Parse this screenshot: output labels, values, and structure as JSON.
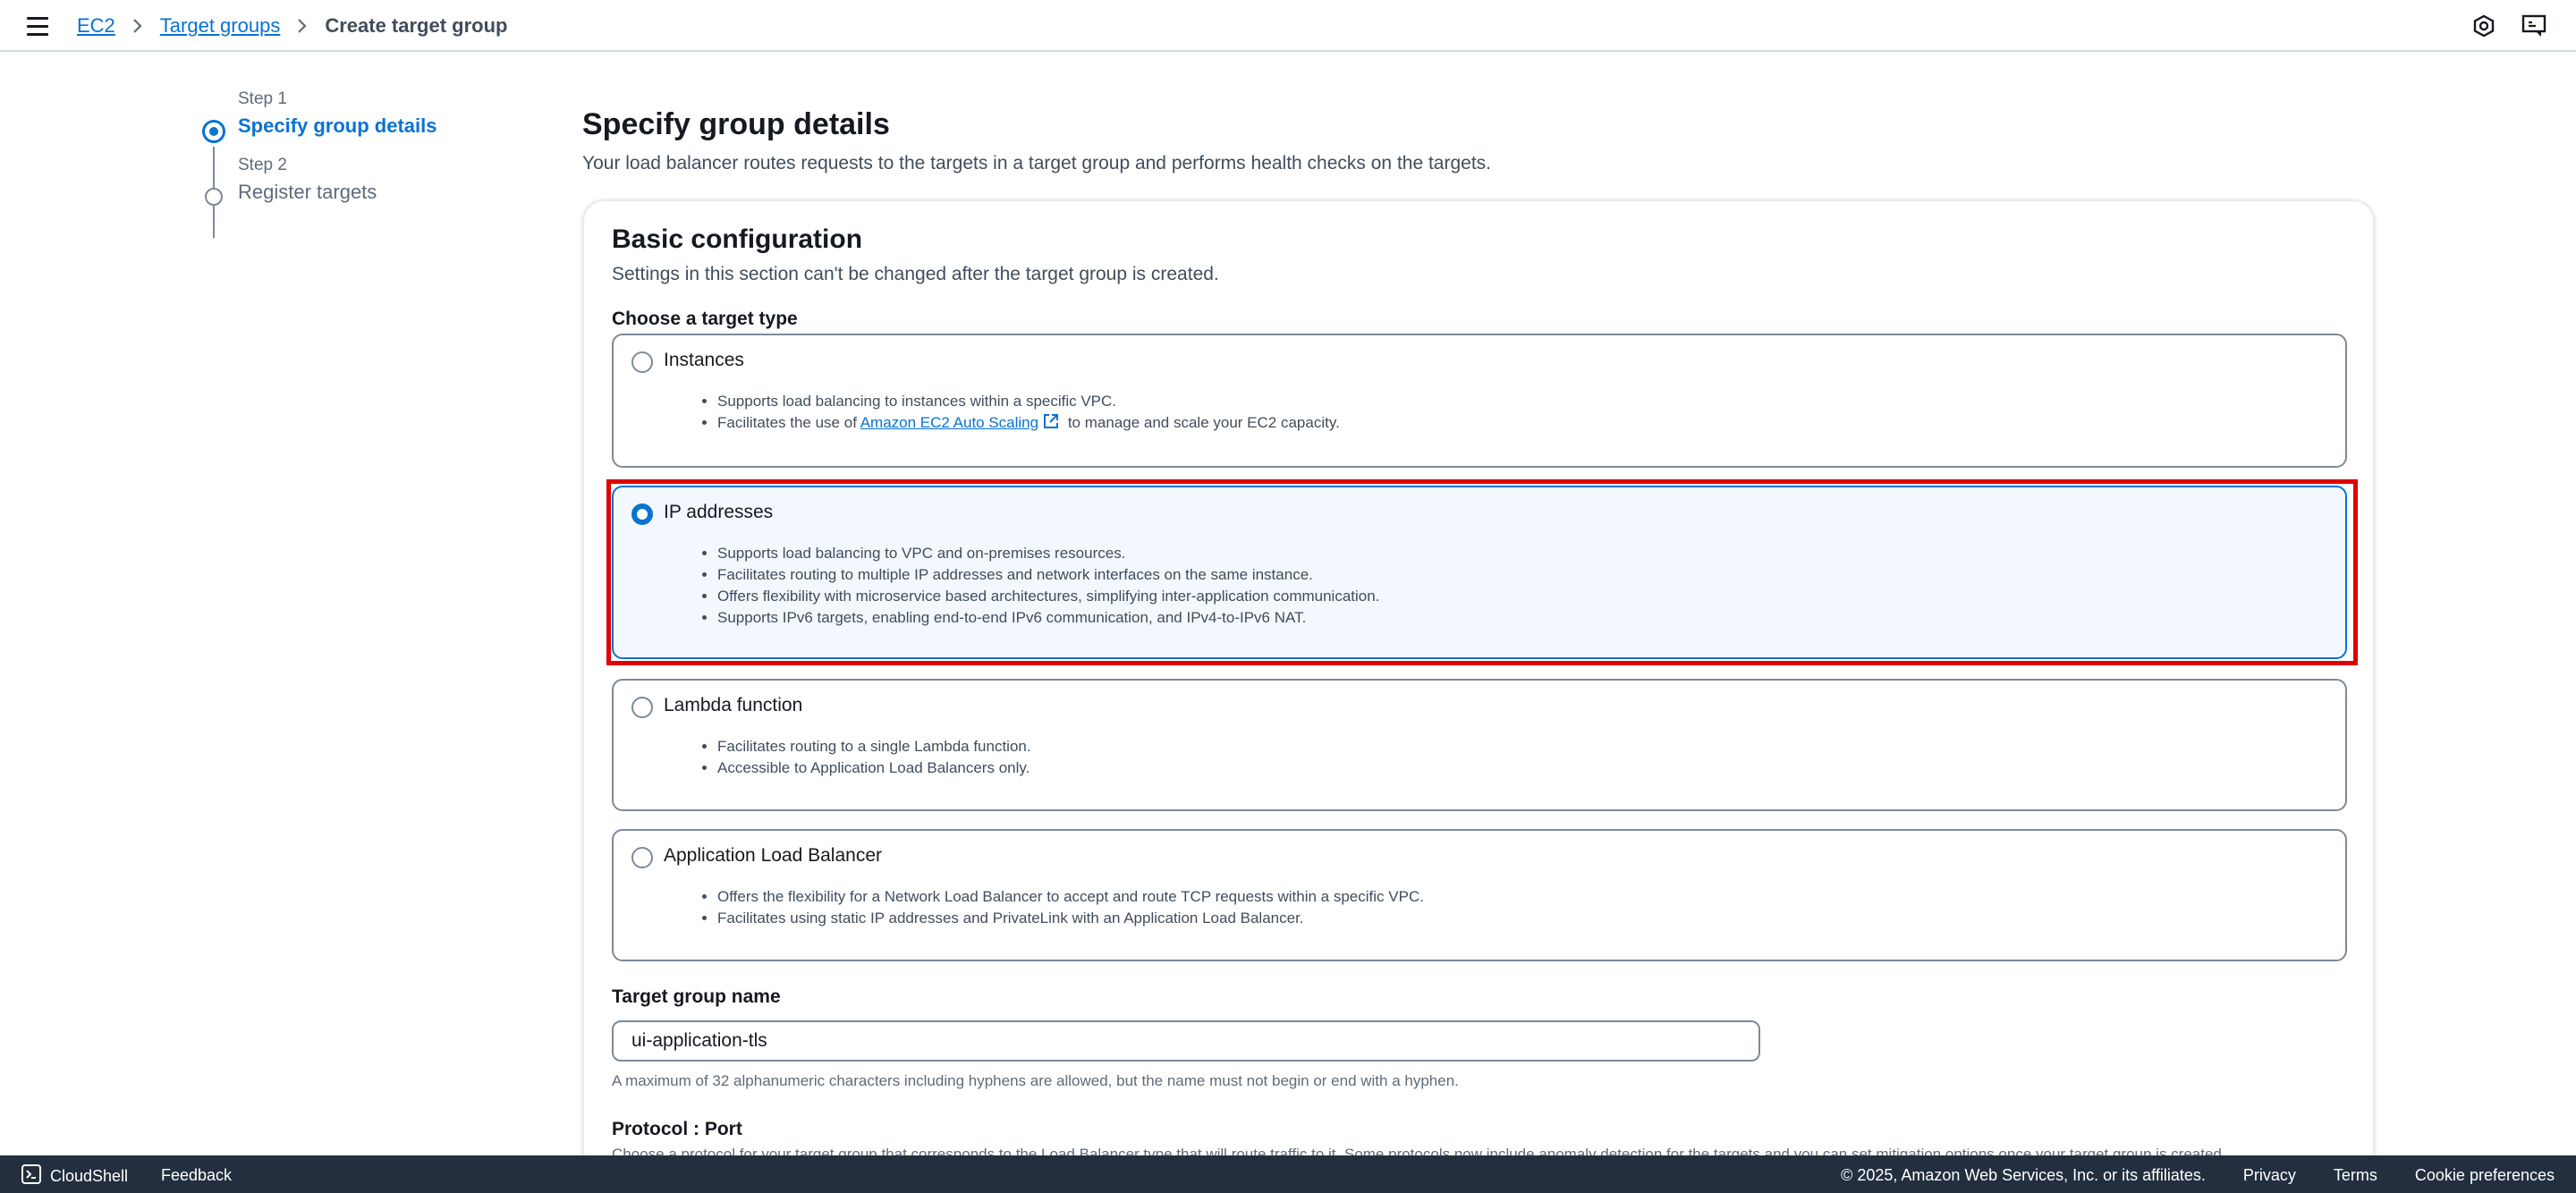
{
  "breadcrumb": {
    "items": [
      "EC2",
      "Target groups"
    ],
    "current": "Create target group"
  },
  "steps": [
    {
      "num": "Step 1",
      "title": "Specify group details",
      "active": true
    },
    {
      "num": "Step 2",
      "title": "Register targets",
      "active": false
    }
  ],
  "page": {
    "title": "Specify group details",
    "description": "Your load balancer routes requests to the targets in a target group and performs health checks on the targets."
  },
  "basic": {
    "title": "Basic configuration",
    "description": "Settings in this section can't be changed after the target group is created.",
    "target_type_label": "Choose a target type"
  },
  "target_types": [
    {
      "title": "Instances",
      "selected": false,
      "bullet1": "Supports load balancing to instances within a specific VPC.",
      "bullet2_pre": "Facilitates the use of ",
      "bullet2_link": "Amazon EC2 Auto Scaling",
      "bullet2_post": " to manage and scale your EC2 capacity."
    },
    {
      "title": "IP addresses",
      "selected": true,
      "bullets": [
        "Supports load balancing to VPC and on-premises resources.",
        "Facilitates routing to multiple IP addresses and network interfaces on the same instance.",
        "Offers flexibility with microservice based architectures, simplifying inter-application communication.",
        "Supports IPv6 targets, enabling end-to-end IPv6 communication, and IPv4-to-IPv6 NAT."
      ]
    },
    {
      "title": "Lambda function",
      "selected": false,
      "bullets": [
        "Facilitates routing to a single Lambda function.",
        "Accessible to Application Load Balancers only."
      ]
    },
    {
      "title": "Application Load Balancer",
      "selected": false,
      "bullets": [
        "Offers the flexibility for a Network Load Balancer to accept and route TCP requests within a specific VPC.",
        "Facilitates using static IP addresses and PrivateLink with an Application Load Balancer."
      ]
    }
  ],
  "target_group_name": {
    "label": "Target group name",
    "value": "ui-application-tls",
    "hint": "A maximum of 32 alphanumeric characters including hyphens are allowed, but the name must not begin or end with a hyphen."
  },
  "protocol": {
    "label": "Protocol : Port",
    "description": "Choose a protocol for your target group that corresponds to the Load Balancer type that will route traffic to it. Some protocols now include anomaly detection for the targets and you can set mitigation options once your target group is created."
  },
  "footer": {
    "cloudshell": "CloudShell",
    "feedback": "Feedback",
    "copyright": "© 2025, Amazon Web Services, Inc. or its affiliates.",
    "privacy": "Privacy",
    "terms": "Terms",
    "cookies": "Cookie preferences"
  },
  "icons": {
    "menu": "menu-icon",
    "notifications": "settings-hex-icon",
    "support": "support-icon",
    "cloudshell": "terminal-icon",
    "external": "external-link-icon"
  },
  "colors": {
    "accent": "#0972d3",
    "highlight": "#e00000",
    "footer_bg": "#232f3e"
  }
}
